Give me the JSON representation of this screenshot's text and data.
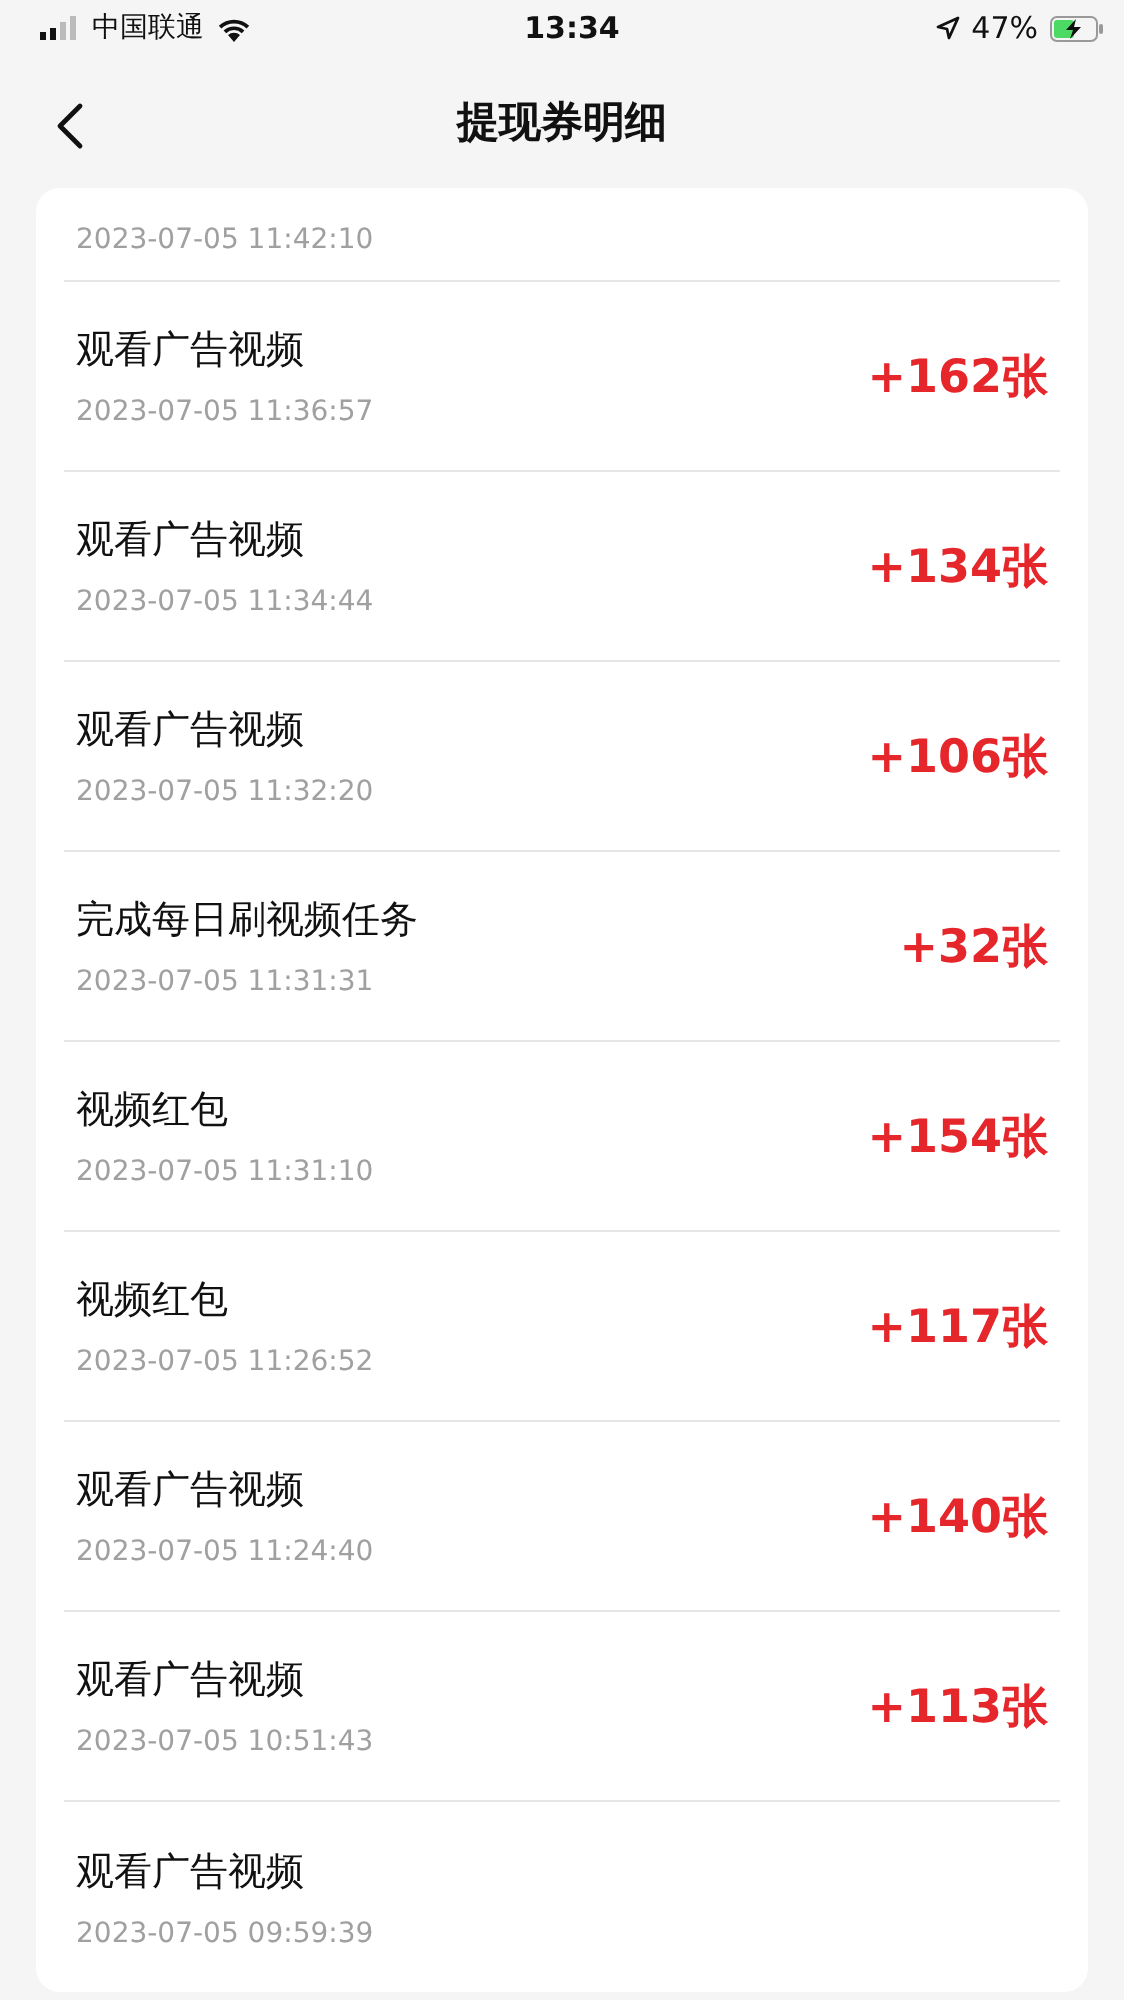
{
  "status_bar": {
    "carrier": "中国联通",
    "time": "13:34",
    "battery_percent": "47%"
  },
  "header": {
    "title": "提现券明细"
  },
  "records": [
    {
      "time": "2023-07-05 11:42:10"
    },
    {
      "title": "观看广告视频",
      "time": "2023-07-05 11:36:57",
      "amount": "+162张"
    },
    {
      "title": "观看广告视频",
      "time": "2023-07-05 11:34:44",
      "amount": "+134张"
    },
    {
      "title": "观看广告视频",
      "time": "2023-07-05 11:32:20",
      "amount": "+106张"
    },
    {
      "title": "完成每日刷视频任务",
      "time": "2023-07-05 11:31:31",
      "amount": "+32张"
    },
    {
      "title": "视频红包",
      "time": "2023-07-05 11:31:10",
      "amount": "+154张"
    },
    {
      "title": "视频红包",
      "time": "2023-07-05 11:26:52",
      "amount": "+117张"
    },
    {
      "title": "观看广告视频",
      "time": "2023-07-05 11:24:40",
      "amount": "+140张"
    },
    {
      "title": "观看广告视频",
      "time": "2023-07-05 10:51:43",
      "amount": "+113张"
    },
    {
      "title": "观看广告视频",
      "time": "2023-07-05 09:59:39"
    }
  ]
}
